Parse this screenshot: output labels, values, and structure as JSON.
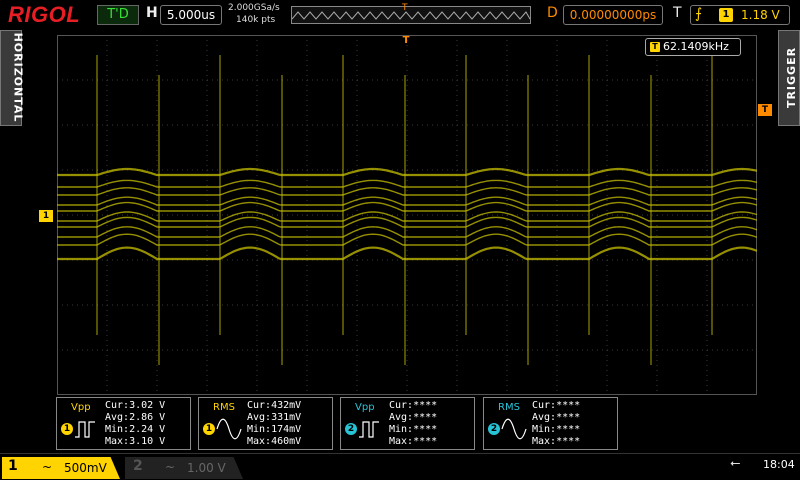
{
  "brand": "RIGOL",
  "status": {
    "run_state": "T'D"
  },
  "horizontal": {
    "label": "H",
    "timebase": "5.000us",
    "sample_rate": "2.000GSa/s",
    "memory_depth": "140k pts",
    "delay_label": "D",
    "delay": "0.00000000ps",
    "trigger_pos_marker": "T"
  },
  "trigger": {
    "label": "T",
    "edge_symbol": "⨍",
    "source": "1",
    "level": "1.18 V",
    "level_marker": "T"
  },
  "side_tabs": {
    "left": "HORIZONTAL",
    "right": "TRIGGER"
  },
  "frequency_counter": {
    "icon": "T",
    "value": "62.1409kHz"
  },
  "channel_marker": "1",
  "colors": {
    "ch1": "#ffd400",
    "ch2": "#27c4d8",
    "trigger": "#ff8a00",
    "brand": "#e81e25"
  },
  "measurements": [
    {
      "label": "Vpp",
      "channel": "1",
      "icon": "pulse-icon",
      "lines": [
        "Cur:3.02 V",
        "Avg:2.86 V",
        "Min:2.24 V",
        "Max:3.10 V"
      ]
    },
    {
      "label": "RMS",
      "channel": "1",
      "icon": "sine-icon",
      "lines": [
        "Cur:432mV",
        "Avg:331mV",
        "Min:174mV",
        "Max:460mV"
      ]
    },
    {
      "label": "Vpp",
      "channel": "2",
      "icon": "pulse-icon",
      "lines": [
        "Cur:****",
        "Avg:****",
        "Min:****",
        "Max:****"
      ]
    },
    {
      "label": "RMS",
      "channel": "2",
      "icon": "sine-icon",
      "lines": [
        "Cur:****",
        "Avg:****",
        "Min:****",
        "Max:****"
      ]
    }
  ],
  "channels": [
    {
      "number": "1",
      "coupling": "~",
      "scale": "500mV",
      "active": true
    },
    {
      "number": "2",
      "coupling": "~",
      "scale": "1.00 V",
      "active": false
    }
  ],
  "clock": "18:04"
}
